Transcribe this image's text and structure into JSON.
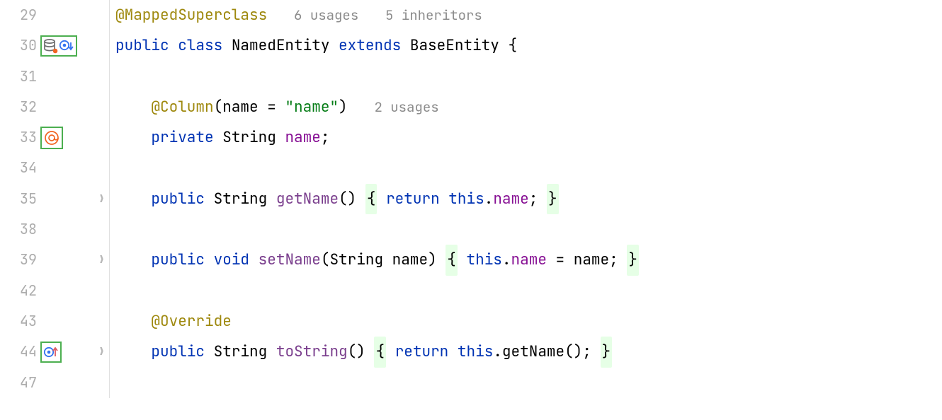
{
  "lines": {
    "l29": "29",
    "l30": "30",
    "l31": "31",
    "l32": "32",
    "l33": "33",
    "l34": "34",
    "l35": "35",
    "l38": "38",
    "l39": "39",
    "l42": "42",
    "l43": "43",
    "l44": "44",
    "l47": "47"
  },
  "code": {
    "annotation_mapped": "@MappedSuperclass",
    "hint_usages6": "6 usages",
    "hint_inheritors5": "5 inheritors",
    "kw_public": "public",
    "kw_class": "class",
    "class_name": "NamedEntity",
    "kw_extends": "extends",
    "super_class": "BaseEntity",
    "brace_open": "{",
    "annotation_column": "@Column",
    "column_args": "(name = ",
    "string_name": "\"name\"",
    "close_paren": ")",
    "hint_usages2": "2 usages",
    "kw_private": "private",
    "type_string": "String",
    "field_name": "name",
    "semicolon": ";",
    "method_getname": "getName",
    "parenpair": "()",
    "fold_open": "{",
    "kw_return": "return",
    "kw_this": "this",
    "dot": ".",
    "fold_close": "}",
    "kw_void": "void",
    "method_setname": "setName",
    "setname_params_open": "(String ",
    "param_name": "name",
    "setname_params_close": ")",
    "assign_eq": " = ",
    "annotation_override": "@Override",
    "method_tostring": "toString",
    "call_getname": "getName()"
  }
}
